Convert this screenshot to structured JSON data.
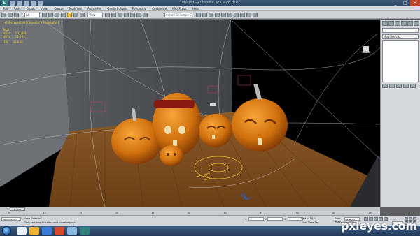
{
  "app": {
    "title": "Untitled - Autodesk 3ds Max 2010",
    "logo_glyph": "S",
    "window_buttons": {
      "minimize": "_",
      "maximize": "□",
      "close": "✕"
    }
  },
  "menu": {
    "items": [
      "Edit",
      "Tools",
      "Group",
      "Views",
      "Create",
      "Modifiers",
      "Animation",
      "Graph Editors",
      "Rendering",
      "Customize",
      "MAXScript",
      "Help"
    ]
  },
  "toolbar": {
    "filter_dropdown": "All",
    "refcoord_dropdown": "View",
    "selection_set_placeholder": "Create Selection Se"
  },
  "viewport": {
    "label": "[+] [Perspective] [Smooth + Highlights]",
    "stats": [
      {
        "label": "Total",
        "value": ""
      },
      {
        "label": "Polys:",
        "value": "103,931"
      },
      {
        "label": "Verts:",
        "value": "53,293"
      },
      {
        "label": "FPS:",
        "value": "48.648"
      }
    ],
    "viewcube_icon": "hat-icon"
  },
  "command_panel": {
    "modifier_list": "Modifier List"
  },
  "timeline": {
    "slider_label": "0 / 100",
    "ticks": [
      "0",
      "10",
      "20",
      "30",
      "40",
      "50",
      "60",
      "70",
      "80",
      "90",
      "100"
    ]
  },
  "status": {
    "mini_listener": "Welcome to M",
    "selection": "None Selected",
    "prompt": "Click and drag to select and move objects",
    "x_label": "X:",
    "y_label": "Y:",
    "z_label": "Z:",
    "x_value": "",
    "y_value": "",
    "z_value": "",
    "grid": "Grid = 10.0",
    "add_time_tag": "Add Time Tag",
    "auto_key": "Auto Key",
    "auto_key_dropdown": "Selected",
    "set_key": "Set Key",
    "key_filters": "Key Filters...",
    "frame": "0"
  },
  "taskbar": {
    "clock_time": "",
    "clock_date": "",
    "icon_colors": [
      "#e8eef5",
      "#f0b030",
      "#3a7bd5",
      "#d9482b",
      "#8ab8e0",
      "#2f7f7d"
    ]
  },
  "watermark": "pxleyes.com"
}
